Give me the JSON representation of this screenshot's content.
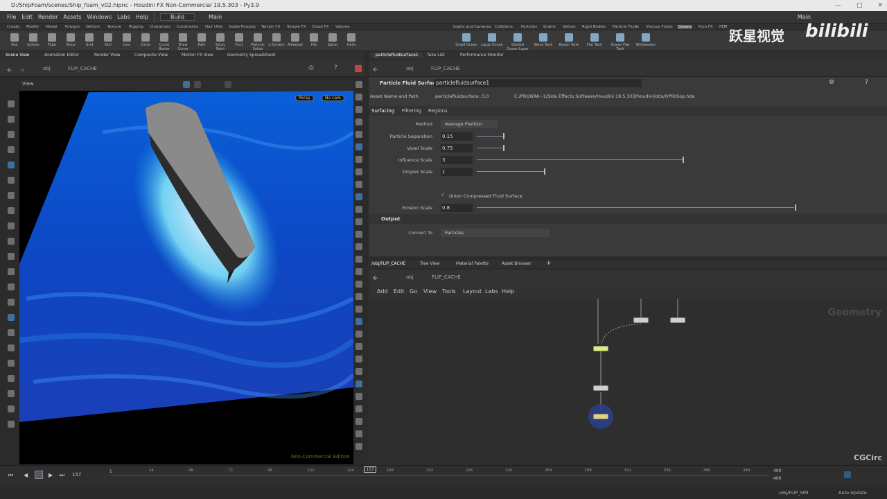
{
  "window": {
    "title": "D:/ShipFoam/scenes/Ship_foam_v02.hipnc - Houdini FX Non-Commercial 19.5.303 - Py3.9"
  },
  "menu": {
    "items": [
      "File",
      "Edit",
      "Render",
      "Assets",
      "Windows",
      "Labs",
      "Help"
    ],
    "build": "Build",
    "desktop": "Main",
    "right_desktop": "Main"
  },
  "shelf": {
    "tabs_left": [
      "Create",
      "Modify",
      "Model",
      "Polygon",
      "Deform",
      "Texture",
      "Rigging",
      "Characters",
      "Constraints",
      "Hair Utils",
      "Guide Process",
      "Terrain FX",
      "Simple FX",
      "Cloud FX",
      "Volume"
    ],
    "tools_left": [
      "Box",
      "Sphere",
      "Tube",
      "Torus",
      "Grid",
      "Null",
      "Line",
      "Circle",
      "Curve Bezier",
      "Draw Curve",
      "Path",
      "Spray Paint",
      "Font",
      "Platonic Solids",
      "L-System",
      "Metaball",
      "File",
      "Spiral",
      "Helix"
    ],
    "tabs_right": [
      "Lights and Cameras",
      "Collisions",
      "Particles",
      "Grains",
      "Vellum",
      "Rigid Bodies",
      "Particle Fluids",
      "Viscous Fluids",
      "Oceans",
      "Pyro FX",
      "FEM"
    ],
    "tools_right": [
      "Small Ocean",
      "Large Ocean",
      "Guided Ocean Layer",
      "Wave Tank",
      "Beach Tank",
      "Flat Tank",
      "Ocean Flat Tank",
      "Whitewater"
    ]
  },
  "left_pane": {
    "tabs": [
      "Scene View",
      "Animation Editor",
      "Render View",
      "Composite View",
      "Motion FX View",
      "Geometry Spreadsheet"
    ],
    "path_obj": "obj",
    "path_node": "FLIP_CACHE",
    "view_label": "View",
    "persp": "Persp",
    "cam": "No cam",
    "watermark": "Non-Commercial Edition"
  },
  "params": {
    "tabs": [
      "particlefluidsurface1",
      "Take List",
      "Performance Monitor"
    ],
    "path_obj": "obj",
    "path_node": "FLIP_CACHE",
    "node_type": "Particle Fluid Surface",
    "node_name": "particlefluidsurface1",
    "asset_label": "Asset Name and Path",
    "asset_name": "particlefluidsurface::3.0",
    "asset_path": "C:/PROGRA~1/Side Effects Software/Houdini 19.5.303/houdini/otls/OPlibSop.hda",
    "subtabs": [
      "Surfacing",
      "Filtering",
      "Regions"
    ],
    "method_label": "Method",
    "method_value": "Average Position",
    "rows": [
      {
        "label": "Particle Separation",
        "value": "0.15",
        "fill": 0.07
      },
      {
        "label": "Voxel Scale",
        "value": "0.75",
        "fill": 0.07
      },
      {
        "label": "Influence Scale",
        "value": "3",
        "fill": 0.55
      },
      {
        "label": "Droplet Scale",
        "value": "1",
        "fill": 0.18
      }
    ],
    "union_label": "Union Compressed Fluid Surface",
    "erosion_label": "Erosion Scale",
    "erosion_value": "0.8",
    "erosion_fill": 0.85,
    "output_header": "Output",
    "convert_label": "Convert To",
    "convert_value": "Particles"
  },
  "network": {
    "tabs": [
      "/obj/FLIP_CACHE",
      "Tree View",
      "Material Palette",
      "Asset Browser"
    ],
    "path_obj": "obj",
    "path_node": "FLIP_CACHE",
    "menu": [
      "Add",
      "Edit",
      "Go",
      "View",
      "Tools",
      "Layout",
      "Labs",
      "Help"
    ],
    "context": "Geometry"
  },
  "timeline": {
    "current_frame": "157",
    "start": "1",
    "ticks": [
      "24",
      "48",
      "72",
      "96",
      "120",
      "144",
      "168",
      "192",
      "216",
      "240",
      "264",
      "288",
      "312",
      "336",
      "360",
      "384"
    ],
    "end1": "400",
    "end2": "400",
    "frame_marker": "157"
  },
  "status": {
    "path": "/obj/FLIP_SIM",
    "auto_update": "Auto Update"
  },
  "overlay": {
    "wm1": "跃星视觉",
    "wm2": "bilibili",
    "wm3": "CGCirc"
  }
}
